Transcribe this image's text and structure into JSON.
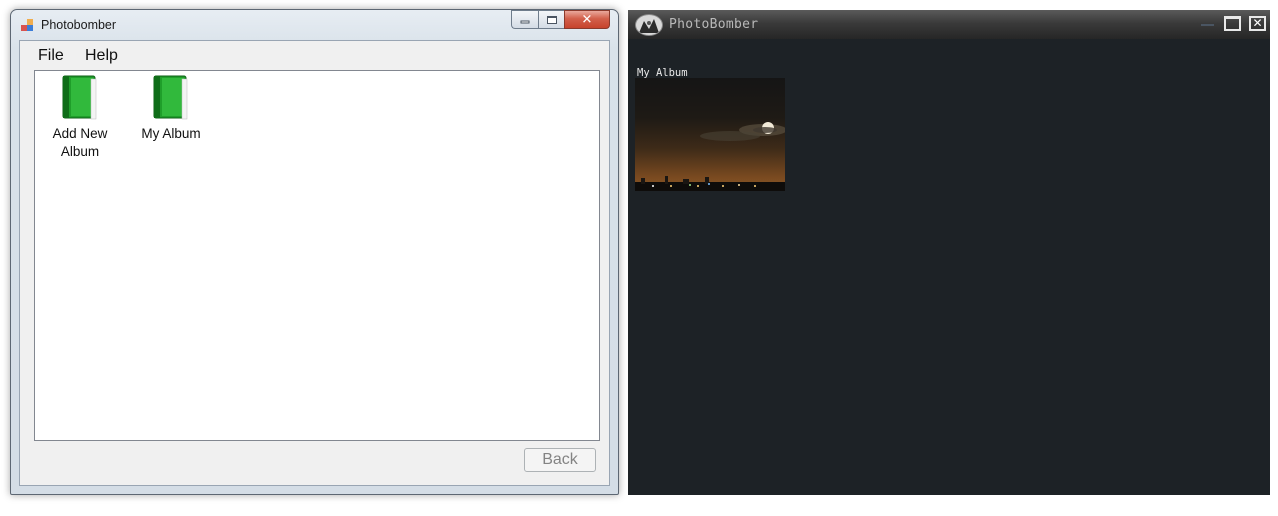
{
  "left_window": {
    "title": "Photobomber",
    "caption_buttons": {
      "minimize": "minimize-icon",
      "maximize": "maximize-icon",
      "close": "✕"
    },
    "menu": [
      {
        "label": "File"
      },
      {
        "label": "Help"
      }
    ],
    "albums": [
      {
        "label_line1": "Add New",
        "label_line2": "Album",
        "icon": "green-book-icon"
      },
      {
        "label_line1": "My Album",
        "label_line2": "",
        "icon": "green-book-icon"
      }
    ],
    "back_button": "Back"
  },
  "right_window": {
    "title": "PhotoBomber",
    "caption_buttons": {
      "minimize": "minimize-icon",
      "maximize": "maximize-icon",
      "close": "✕"
    },
    "album_title": "My Album",
    "thumbnail": "night-city-moon-photo"
  },
  "colors": {
    "book_green": "#1f9e2a",
    "dark_bg": "#1d2226",
    "close_red": "#c7432c"
  }
}
